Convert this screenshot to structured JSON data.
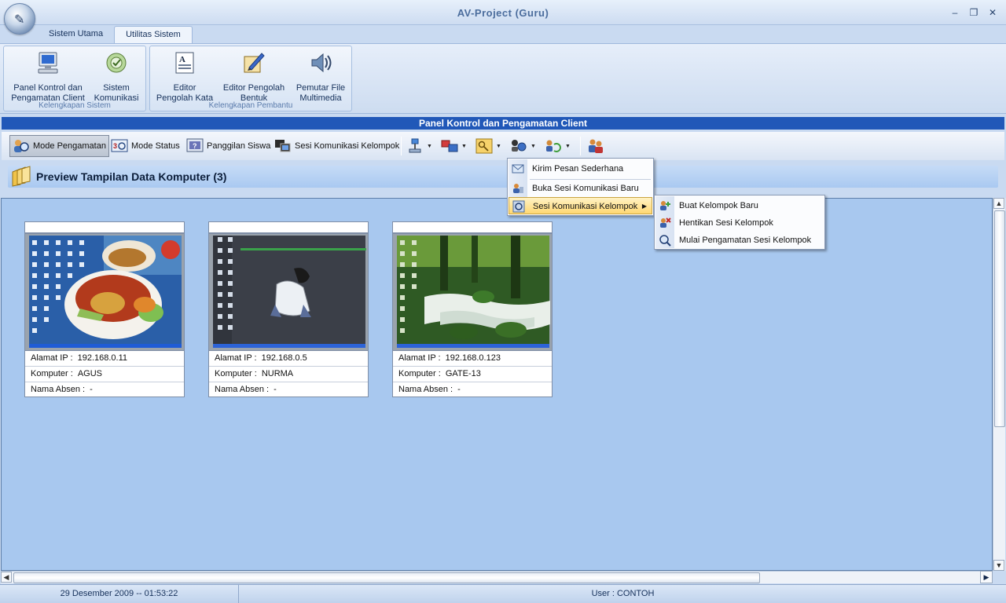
{
  "window": {
    "title": "AV-Project (Guru)",
    "orb_glyph": "✎"
  },
  "ribbon": {
    "tabs": [
      {
        "label": "Sistem Utama",
        "active": false
      },
      {
        "label": "Utilitas Sistem",
        "active": true
      }
    ],
    "groups": [
      {
        "label": "Kelengkapan Sistem",
        "buttons": [
          {
            "line1": "Panel Kontrol dan",
            "line2": "Pengamatan Client",
            "icon": "monitor-icon"
          },
          {
            "line1": "Sistem",
            "line2": "Komunikasi",
            "icon": "communication-icon"
          }
        ]
      },
      {
        "label": "Kelengkapan Pembantu",
        "buttons": [
          {
            "line1": "Editor",
            "line2": "Pengolah Kata",
            "icon": "text-editor-icon"
          },
          {
            "line1": "Editor Pengolah",
            "line2": "Bentuk",
            "icon": "drawing-editor-icon"
          },
          {
            "line1": "Pemutar File",
            "line2": "Multimedia",
            "icon": "media-player-icon"
          }
        ]
      }
    ]
  },
  "panel": {
    "title": "Panel Kontrol dan Pengamatan Client"
  },
  "toolbar": {
    "mode_pengamatan": "Mode Pengamatan",
    "mode_status": "Mode Status",
    "panggilan_siswa": "Panggilan Siswa",
    "sesi_komunikasi_kelompok": "Sesi Komunikasi Kelompok"
  },
  "preview": {
    "title": "Preview Tampilan Data Komputer (3)"
  },
  "labels": {
    "ip": "Alamat IP :",
    "computer": "Komputer :",
    "absen": "Nama Absen :"
  },
  "computers": [
    {
      "ip": "192.168.0.11",
      "name": "AGUS",
      "absen": "-"
    },
    {
      "ip": "192.168.0.5",
      "name": "NURMA",
      "absen": "-"
    },
    {
      "ip": "192.168.0.123",
      "name": "GATE-13",
      "absen": "-"
    }
  ],
  "menu": {
    "items": [
      "Kirim Pesan Sederhana",
      "Buka Sesi Komunikasi Baru",
      "Sesi Komunikasi Kelompok"
    ],
    "submenu": [
      "Buat Kelompok Baru",
      "Hentikan Sesi Kelompok",
      "Mulai Pengamatan Sesi Kelompok"
    ]
  },
  "status": {
    "datetime": "29 Desember 2009 -- 01:53:22",
    "user": "User : CONTOH"
  },
  "colors": {
    "panel_bar": "#2158b8",
    "content_bg": "#a8c8ef",
    "menu_highlight": "#ffd873"
  }
}
